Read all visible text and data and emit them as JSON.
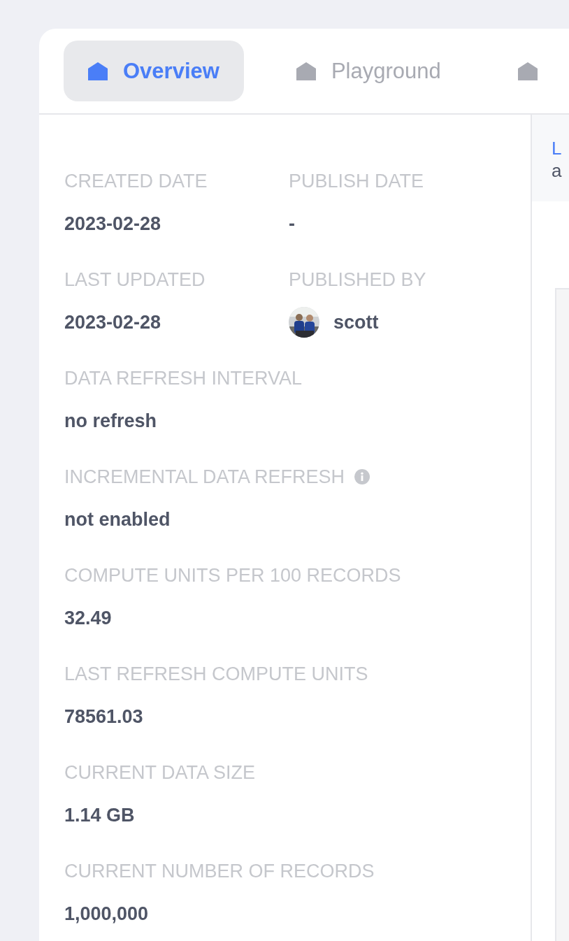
{
  "tabs": [
    {
      "label": "Overview",
      "selected": true
    },
    {
      "label": "Playground",
      "selected": false
    },
    {
      "selected": false
    }
  ],
  "details": [
    [
      {
        "label": "CREATED DATE",
        "value": "2023-02-28"
      },
      {
        "label": "PUBLISH DATE",
        "value": "-"
      }
    ],
    [
      {
        "label": "LAST UPDATED",
        "value": "2023-02-28"
      },
      {
        "label": "PUBLISHED BY",
        "value": "scott",
        "kind": "user"
      }
    ],
    [
      {
        "label": "DATA REFRESH INTERVAL",
        "value": "no refresh"
      }
    ],
    [
      {
        "label": "INCREMENTAL DATA REFRESH",
        "value": "not enabled",
        "info": true
      }
    ],
    [
      {
        "label": "COMPUTE UNITS PER 100 RECORDS",
        "value": "32.49"
      }
    ],
    [
      {
        "label": "LAST REFRESH COMPUTE UNITS",
        "value": "78561.03"
      }
    ],
    [
      {
        "label": "CURRENT DATA SIZE",
        "value": "1.14 GB"
      }
    ],
    [
      {
        "label": "CURRENT NUMBER OF RECORDS",
        "value": "1,000,000"
      }
    ]
  ],
  "side_panel": {
    "link": "L",
    "text": "a"
  }
}
